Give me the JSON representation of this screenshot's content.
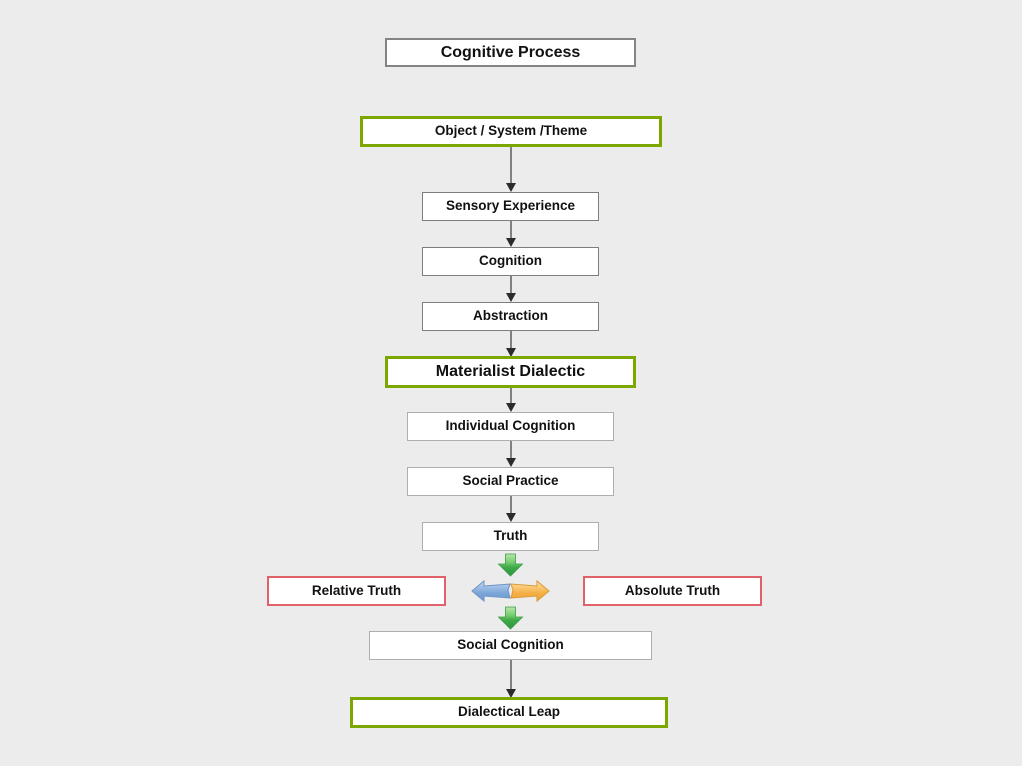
{
  "diagram": {
    "title": "Cognitive Process",
    "background_color": "#ececec",
    "accent_colors": {
      "green_border": "#7ba700",
      "red_border": "#e0616a",
      "gray_border_dark": "#7d7d7d",
      "gray_border_light": "#aeaeae",
      "title_border": "#848484",
      "connector": "#545454",
      "arrow_left_blue": "#6f9fd8",
      "arrow_right_orange": "#f0ab3d",
      "arrow_down_green": "#3fae49"
    },
    "nodes": [
      {
        "id": "title",
        "label": "Cognitive Process",
        "style": "title"
      },
      {
        "id": "object-system-theme",
        "label": "Object / System /Theme",
        "style": "green"
      },
      {
        "id": "sensory-experience",
        "label": "Sensory Experience",
        "style": "gray-dark"
      },
      {
        "id": "cognition",
        "label": "Cognition",
        "style": "gray-dark"
      },
      {
        "id": "abstraction",
        "label": "Abstraction",
        "style": "gray-dark"
      },
      {
        "id": "materialist-dialectic",
        "label": "Materialist Dialectic",
        "style": "green"
      },
      {
        "id": "individual-cognition",
        "label": "Individual Cognition",
        "style": "gray-light"
      },
      {
        "id": "social-practice",
        "label": "Social Practice",
        "style": "gray-light"
      },
      {
        "id": "truth",
        "label": "Truth",
        "style": "gray-light"
      },
      {
        "id": "relative-truth",
        "label": "Relative Truth",
        "style": "red"
      },
      {
        "id": "absolute-truth",
        "label": "Absolute Truth",
        "style": "red"
      },
      {
        "id": "social-cognition",
        "label": "Social Cognition",
        "style": "gray-light"
      },
      {
        "id": "dialectical-leap",
        "label": "Dialectical Leap",
        "style": "green"
      }
    ],
    "icons": {
      "down_arrow_green_top": "green-down-arrow-icon",
      "down_arrow_green_bottom": "green-down-arrow-icon",
      "left_arrow_blue": "blue-left-arrow-icon",
      "right_arrow_orange": "orange-right-arrow-icon"
    },
    "edges": [
      {
        "from": "object-system-theme",
        "to": "sensory-experience"
      },
      {
        "from": "sensory-experience",
        "to": "cognition"
      },
      {
        "from": "cognition",
        "to": "abstraction"
      },
      {
        "from": "abstraction",
        "to": "materialist-dialectic"
      },
      {
        "from": "materialist-dialectic",
        "to": "individual-cognition"
      },
      {
        "from": "individual-cognition",
        "to": "social-practice"
      },
      {
        "from": "social-practice",
        "to": "truth"
      },
      {
        "from": "truth",
        "to": "relative-truth-absolute-truth"
      },
      {
        "from": "relative-truth-absolute-truth",
        "to": "social-cognition"
      },
      {
        "from": "social-cognition",
        "to": "dialectical-leap"
      }
    ]
  }
}
